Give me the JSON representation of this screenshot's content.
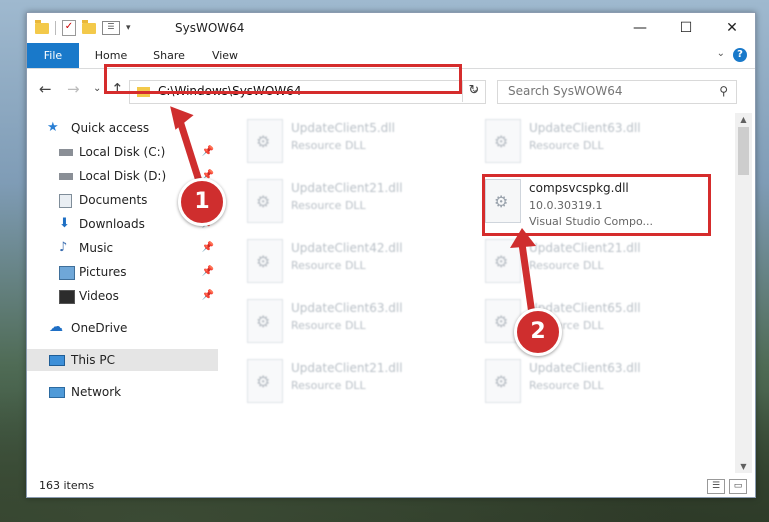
{
  "window": {
    "title": "SysWOW64",
    "minimize": "—",
    "maximize": "☐",
    "close": "✕"
  },
  "ribbon": {
    "tabs": [
      "File",
      "Home",
      "Share",
      "View"
    ]
  },
  "address": {
    "path": "C:\\Windows\\SysWOW64"
  },
  "search": {
    "placeholder": "Search SysWOW64"
  },
  "sidebar": {
    "items": [
      {
        "label": "Quick access",
        "icon": "star-icon",
        "pinned": false
      },
      {
        "label": "Local Disk (C:)",
        "icon": "drive-icon",
        "pinned": true
      },
      {
        "label": "Local Disk (D:)",
        "icon": "drive-icon",
        "pinned": true
      },
      {
        "label": "Documents",
        "icon": "documents-icon",
        "pinned": true
      },
      {
        "label": "Downloads",
        "icon": "download-icon",
        "pinned": true
      },
      {
        "label": "Music",
        "icon": "music-icon",
        "pinned": true
      },
      {
        "label": "Pictures",
        "icon": "pictures-icon",
        "pinned": true
      },
      {
        "label": "Videos",
        "icon": "videos-icon",
        "pinned": true
      },
      {
        "label": "OneDrive",
        "icon": "cloud-icon",
        "pinned": false
      },
      {
        "label": "This PC",
        "icon": "computer-icon",
        "pinned": false
      },
      {
        "label": "Network",
        "icon": "network-icon",
        "pinned": false
      }
    ]
  },
  "files": {
    "left": [
      {
        "name": "UpdateClient5.dll",
        "desc": "Resource DLL"
      },
      {
        "name": "UpdateClient21.dll",
        "desc": "Resource DLL"
      },
      {
        "name": "UpdateClient42.dll",
        "desc": "Resource DLL"
      },
      {
        "name": "UpdateClient63.dll",
        "desc": "Resource DLL"
      },
      {
        "name": "UpdateClient21.dll",
        "desc": "Resource DLL"
      }
    ],
    "right": [
      {
        "name": "UpdateClient63.dll",
        "desc": "Resource DLL"
      },
      {
        "name": "UpdateClient21.dll",
        "desc": "Resource DLL"
      },
      {
        "name": "UpdateClient65.dll",
        "desc": "Resource DLL"
      },
      {
        "name": "UpdateClient63.dll",
        "desc": "Resource DLL"
      }
    ],
    "highlighted": {
      "name": "compsvcspkg.dll",
      "version": "10.0.30319.1",
      "desc": "Visual Studio Compo..."
    }
  },
  "status": {
    "count": "163 items"
  },
  "annotations": {
    "step1": "1",
    "step2": "2",
    "color": "#cf2e2e"
  }
}
